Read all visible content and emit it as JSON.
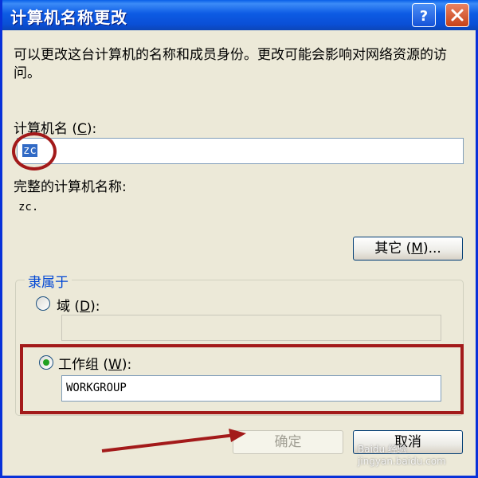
{
  "window": {
    "title": "计算机名称更改"
  },
  "description": "可以更改这台计算机的名称和成员身份。更改可能会影响对网络资源的访问。",
  "computer_name": {
    "label_prefix": "计算机名 (",
    "label_key": "C",
    "label_suffix": "):",
    "value": "zc"
  },
  "full_name": {
    "label": "完整的计算机名称:",
    "value": "zc."
  },
  "other_button": {
    "prefix": "其它 (",
    "key": "M",
    "suffix": ")..."
  },
  "member_of": {
    "title": "隶属于",
    "domain": {
      "prefix": "域 (",
      "key": "D",
      "suffix": "):",
      "value": "",
      "selected": false
    },
    "workgroup": {
      "prefix": "工作组 (",
      "key": "W",
      "suffix": "):",
      "value": "WORKGROUP",
      "selected": true
    }
  },
  "buttons": {
    "ok": "确定",
    "cancel": "取消"
  },
  "watermark": "Baidu 经验 jingyan.baidu.com",
  "colors": {
    "title_bar": "#0A5FE8",
    "highlight": "#A31A1A",
    "selection": "#316AC5",
    "group_title": "#0046D5"
  }
}
